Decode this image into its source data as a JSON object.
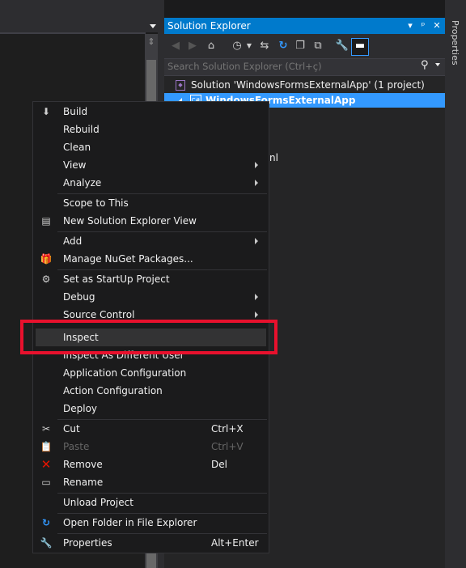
{
  "solution_explorer": {
    "title": "Solution Explorer",
    "search_placeholder": "Search Solution Explorer (Ctrl+ç)",
    "solution_label": "Solution 'WindowsFormsExternalApp' (1 project)",
    "project_label": "WindowsFormsExternalApp",
    "partial_text": "nl",
    "title_buttons": [
      "▾",
      "📌",
      "✕"
    ]
  },
  "side_panel": {
    "label": "Properties"
  },
  "menu": {
    "items": [
      {
        "label": "Build",
        "icon": "build-icon"
      },
      {
        "label": "Rebuild"
      },
      {
        "label": "Clean"
      },
      {
        "label": "View",
        "submenu": true
      },
      {
        "label": "Analyze",
        "submenu": true
      },
      {
        "label": "Scope to This"
      },
      {
        "label": "New Solution Explorer View",
        "icon": "new-view-icon"
      },
      {
        "label": "Add",
        "submenu": true
      },
      {
        "label": "Manage NuGet Packages...",
        "icon": "nuget-icon"
      },
      {
        "label": "Set as StartUp Project",
        "icon": "gear-icon"
      },
      {
        "label": "Debug",
        "submenu": true
      },
      {
        "label": "Source Control",
        "submenu": true
      },
      {
        "label": "Inspect"
      },
      {
        "label": "Inspect As Different User"
      },
      {
        "label": "Application Configuration"
      },
      {
        "label": "Action Configuration"
      },
      {
        "label": "Deploy"
      },
      {
        "label": "Cut",
        "shortcut": "Ctrl+X",
        "icon": "cut-icon"
      },
      {
        "label": "Paste",
        "shortcut": "Ctrl+V",
        "icon": "paste-icon",
        "disabled": true
      },
      {
        "label": "Remove",
        "shortcut": "Del",
        "icon": "remove-icon"
      },
      {
        "label": "Rename",
        "icon": "rename-icon"
      },
      {
        "label": "Unload Project"
      },
      {
        "label": "Open Folder in File Explorer",
        "icon": "refresh-icon"
      },
      {
        "label": "Properties",
        "shortcut": "Alt+Enter",
        "icon": "wrench-icon"
      }
    ]
  },
  "colors": {
    "accent": "#007acc",
    "selection": "#3399ff",
    "highlight_box": "#e8112d",
    "remove_icon": "#e51400"
  }
}
